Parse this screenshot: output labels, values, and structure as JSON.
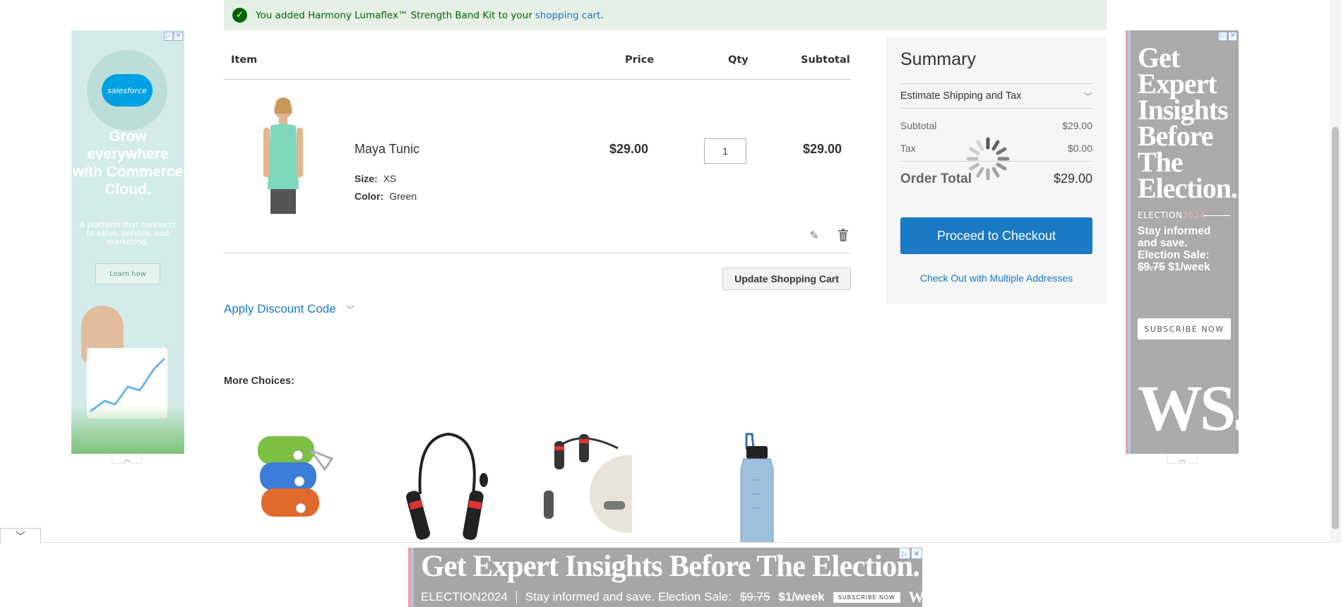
{
  "message": {
    "text_prefix": "You added Harmony Lumaflex™ Strength Band Kit to your",
    "link": "shopping cart",
    "suffix": "."
  },
  "cart": {
    "headers": {
      "item": "Item",
      "price": "Price",
      "qty": "Qty",
      "subtotal": "Subtotal"
    },
    "items": [
      {
        "name": "Maya Tunic",
        "options": [
          {
            "label": "Size:",
            "value": "XS"
          },
          {
            "label": "Color:",
            "value": "Green"
          }
        ],
        "price": "$29.00",
        "qty": "1",
        "subtotal": "$29.00"
      }
    ],
    "update_button": "Update Shopping Cart",
    "discount_link": "Apply Discount Code"
  },
  "summary": {
    "title": "Summary",
    "estimate": "Estimate Shipping and Tax",
    "subtotal_label": "Subtotal",
    "subtotal_value": "$29.00",
    "tax_label": "Tax",
    "tax_value": "$0.00",
    "total_label": "Order Total",
    "total_value": "$29.00",
    "checkout_button": "Proceed to Checkout",
    "multi_address_link": "Check Out with Multiple Addresses"
  },
  "more_choices": {
    "title": "More Choices:",
    "products": [
      "yoga-strap-set",
      "jump-rope",
      "jump-rope-kit-with-bag",
      "water-bottle"
    ]
  },
  "ads": {
    "left": {
      "brand": "salesforce",
      "headline": "Grow everywhere with Commerce Cloud.",
      "sub": "A platform that connects to sales, service, and marketing.",
      "cta": "Learn how"
    },
    "right": {
      "headline": "Get Expert Insights Before The Election.",
      "election_prefix": "ELECTION",
      "election_year": "2024",
      "stay": "Stay informed and save. Election Sale:",
      "old_price": "$9.75",
      "new_price": "$1/week",
      "cta": "SUBSCRIBE NOW",
      "brand": "WSJ"
    },
    "bottom": {
      "headline": "Get Expert Insights Before The Election.",
      "election_prefix": "ELECTION",
      "election_year": "2024",
      "stay": "Stay informed and save. Election Sale:",
      "old_price": "$9.75",
      "new_price": "$1/week",
      "cta": "SUBSCRIBE NOW",
      "brand": "WSJ"
    },
    "adchoices": "▷",
    "close": "✕"
  },
  "colors": {
    "accent": "#1979c3",
    "success_bg": "#e5efe5",
    "success_text": "#006400"
  }
}
